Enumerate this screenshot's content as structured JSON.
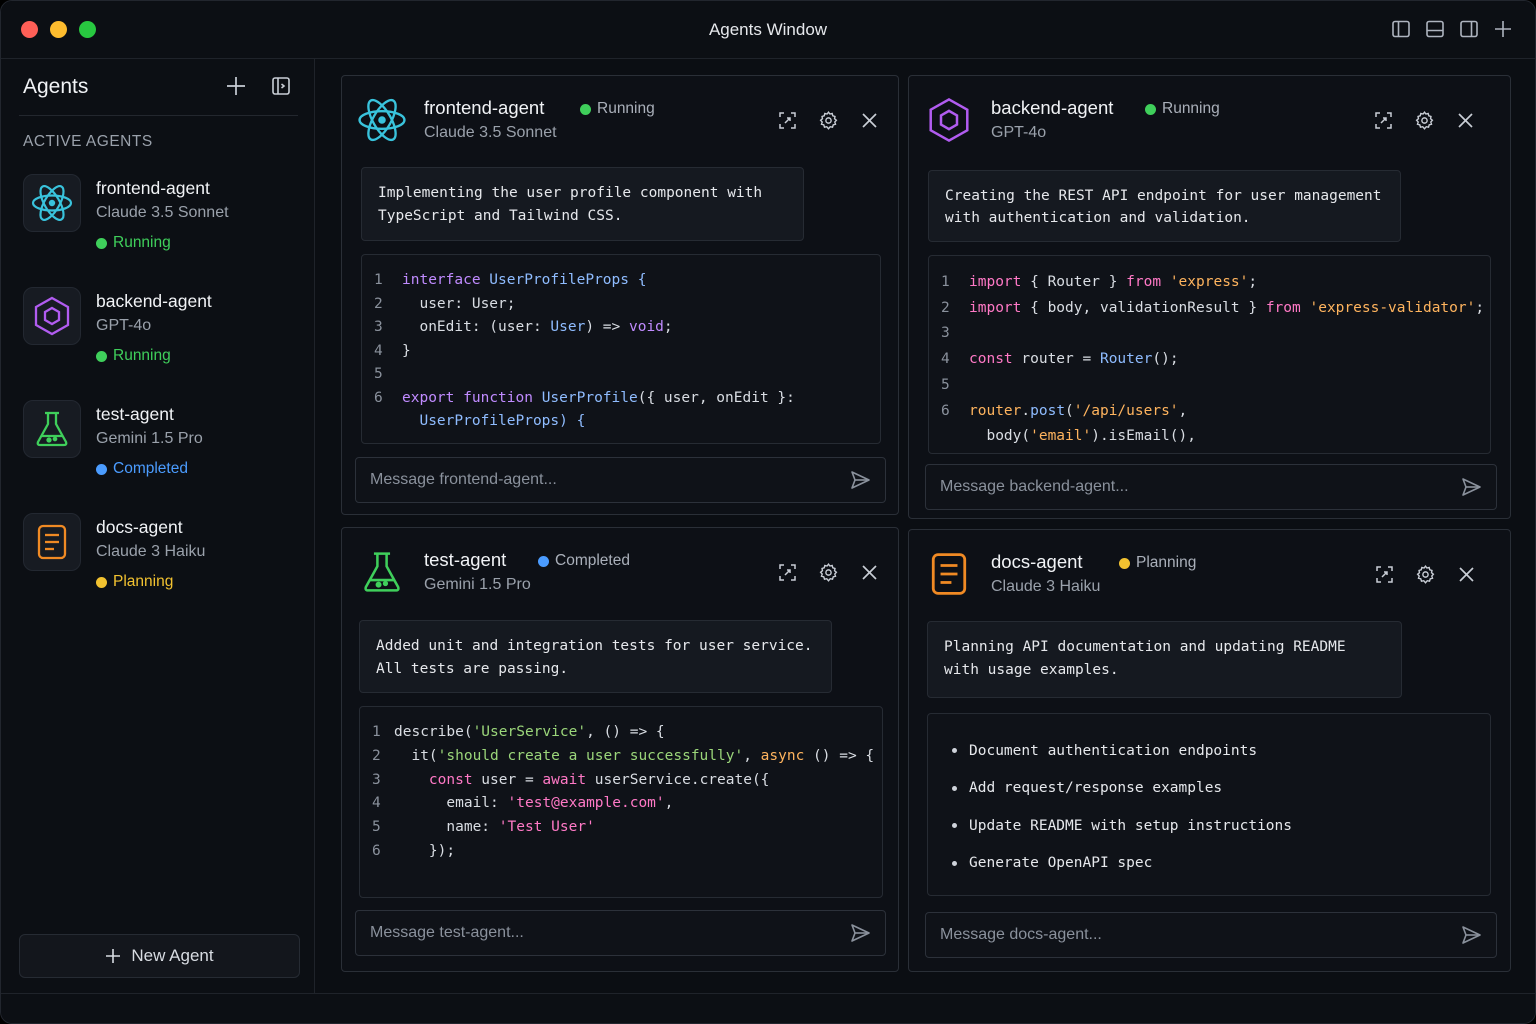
{
  "window": {
    "title": "Agents Window"
  },
  "sidebar": {
    "title": "Agents",
    "section_label": "ACTIVE AGENTS",
    "new_agent_label": "New Agent",
    "items": [
      {
        "name": "frontend-agent",
        "model": "Claude 3.5 Sonnet",
        "status": "Running",
        "status_color": "#3fcf5b",
        "icon": "react-icon"
      },
      {
        "name": "backend-agent",
        "model": "GPT-4o",
        "status": "Running",
        "status_color": "#3fcf5b",
        "icon": "hexagon-icon"
      },
      {
        "name": "test-agent",
        "model": "Gemini 1.5 Pro",
        "status": "Completed",
        "status_color": "#4b9cff",
        "icon": "flask-icon"
      },
      {
        "name": "docs-agent",
        "model": "Claude 3 Haiku",
        "status": "Planning",
        "status_color": "#f2c230",
        "icon": "document-icon"
      }
    ]
  },
  "panels": {
    "frontend": {
      "name": "frontend-agent",
      "model": "Claude 3.5 Sonnet",
      "status": "Running",
      "message": "Implementing the user profile component with\nTypeScript and Tailwind CSS.",
      "input_placeholder": "Message frontend-agent..."
    },
    "backend": {
      "name": "backend-agent",
      "model": "GPT-4o",
      "status": "Running",
      "message": "Creating the REST API endpoint for user management\nwith authentication and validation.",
      "input_placeholder": "Message backend-agent..."
    },
    "test": {
      "name": "test-agent",
      "model": "Gemini 1.5 Pro",
      "status": "Completed",
      "message": "Added unit and integration tests for user service.\nAll tests are passing.",
      "input_placeholder": "Message test-agent..."
    },
    "docs": {
      "name": "docs-agent",
      "model": "Claude 3 Haiku",
      "status": "Planning",
      "message": "Planning API documentation and updating README\nwith usage examples.",
      "input_placeholder": "Message docs-agent...",
      "plan": [
        "Document authentication endpoints",
        "Add request/response examples",
        "Update README with setup instructions",
        "Generate OpenAPI spec"
      ]
    }
  },
  "code": {
    "frontend": {
      "l1": [
        "interface",
        " UserProfileProps {"
      ],
      "l2": "  user: User;",
      "l3": [
        "  onEdit: (user: ",
        "User",
        ") => ",
        "void",
        ";"
      ],
      "l4": "}",
      "l6": [
        "export",
        " ",
        "function",
        " ",
        "UserProfile",
        "({ user, onEdit }:"
      ],
      "l6b": "  UserProfileProps) {"
    },
    "backend": {
      "l1": [
        "import",
        " { Router } ",
        "from",
        " ",
        "'express'",
        ";"
      ],
      "l2": [
        "import",
        " { body, validationResult } ",
        "from",
        " ",
        "'express-validator'",
        ";"
      ],
      "l4": [
        "const",
        " router = ",
        "Router",
        "();"
      ],
      "l6": [
        "router",
        ".",
        "post",
        "(",
        "'/api/users'",
        ","
      ],
      "l6b": [
        "  body(",
        "'email'",
        ").isEmail(),"
      ]
    },
    "test": {
      "l1": [
        "describe(",
        "'UserService'",
        ", () => {"
      ],
      "l2": [
        "  it(",
        "'should create a user successfully'",
        ", ",
        "async",
        " () => {"
      ],
      "l3": [
        "    ",
        "const",
        " user = ",
        "await",
        " userService.create({"
      ],
      "l4": [
        "      email: ",
        "'test@example.com'",
        ","
      ],
      "l5": [
        "      name: ",
        "'Test User'"
      ],
      "l6": "    });"
    },
    "line_numbers": [
      "1",
      "2",
      "3",
      "4",
      "5",
      "6"
    ]
  }
}
